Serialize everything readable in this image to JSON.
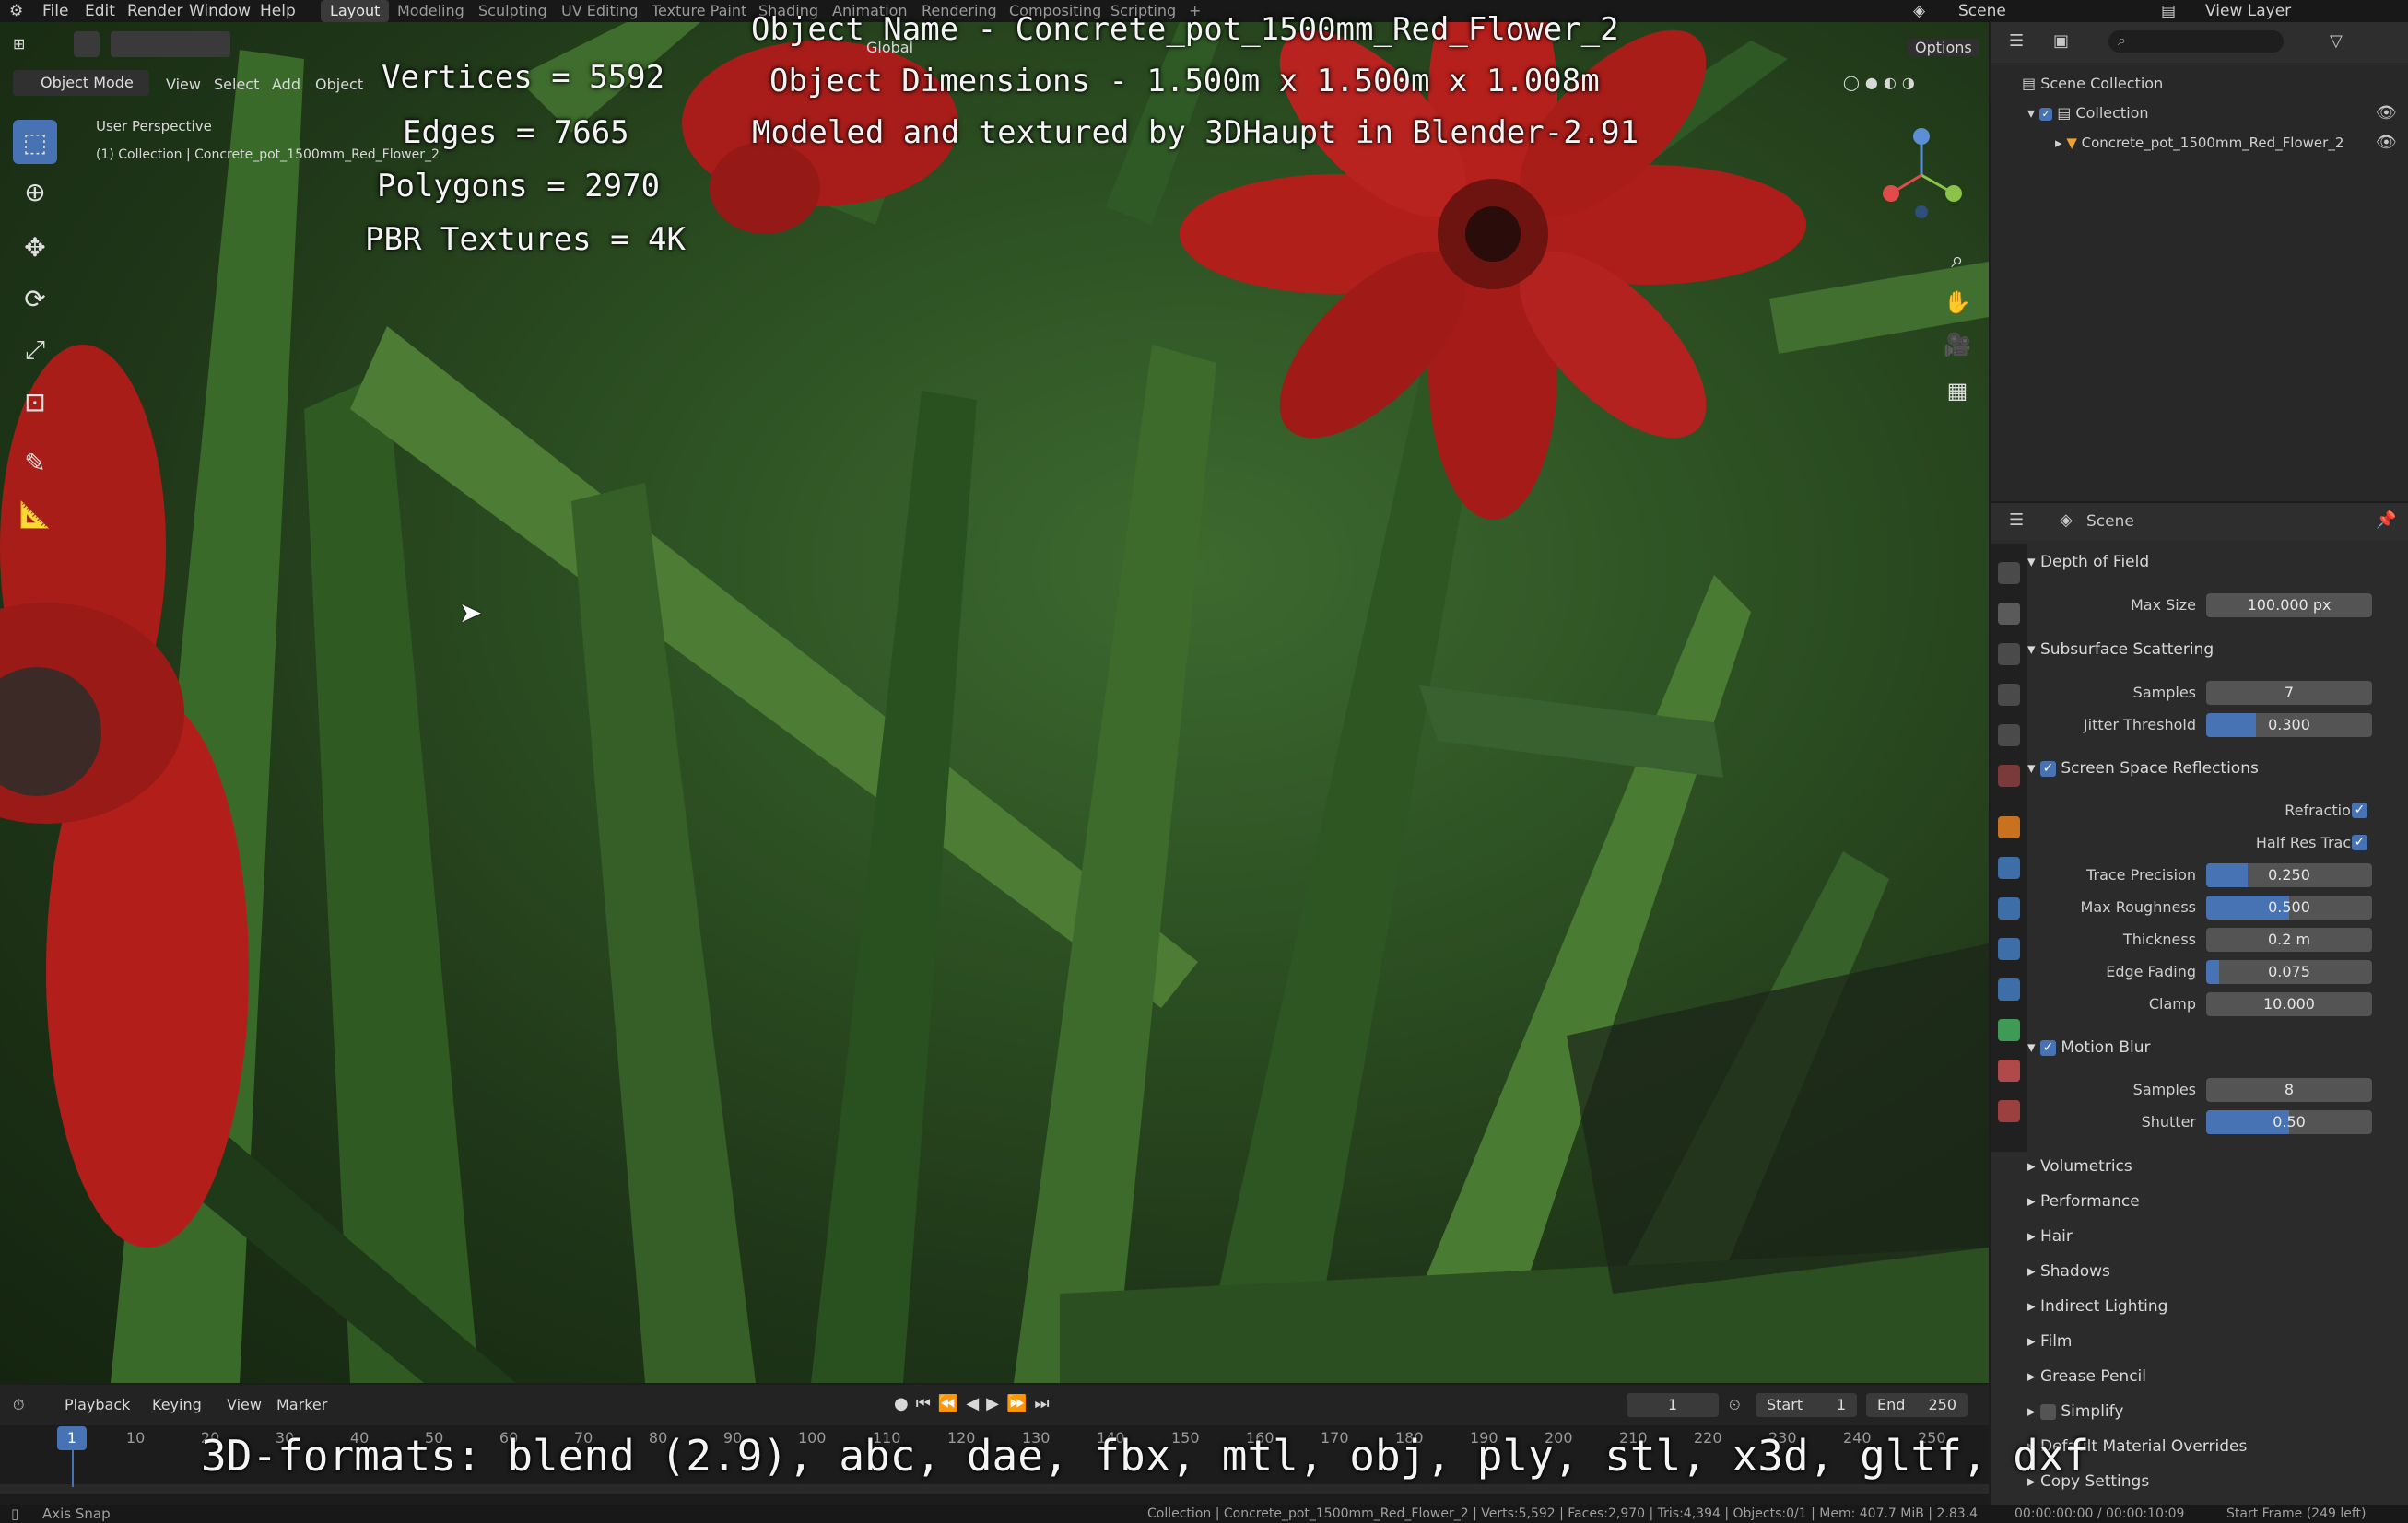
{
  "menubar": {
    "items": [
      "File",
      "Edit",
      "Render",
      "Window",
      "Help"
    ],
    "workspaces": [
      "Layout",
      "Modeling",
      "Sculpting",
      "UV Editing",
      "Texture Paint",
      "Shading",
      "Animation",
      "Rendering",
      "Compositing",
      "Scripting"
    ],
    "active_workspace": "Layout",
    "scene": "Scene",
    "view_layer": "View Layer"
  },
  "viewport": {
    "mode": "Object Mode",
    "menus": [
      "View",
      "Select",
      "Add",
      "Object"
    ],
    "orientation": "Global",
    "options_label": "Options",
    "perspective": "User Perspective",
    "collection_path": "(1) Collection | Concrete_pot_1500mm_Red_Flower_2",
    "overlay": {
      "vertices": "Vertices = 5592",
      "edges": "Edges = 7665",
      "polygons": "Polygons = 2970",
      "textures": "PBR Textures = 4K",
      "name": "Object Name - Concrete_pot_1500mm_Red_Flower_2",
      "dimensions": "Object Dimensions -  1.500m x 1.500m x 1.008m",
      "credit": "Modeled and textured by 3DHaupt in Blender-2.91",
      "formats": "3D-formats: blend (2.9), abc, dae, fbx, mtl, obj, ply, stl, x3d, gltf, dxf"
    }
  },
  "outliner": {
    "scene_collection": "Scene Collection",
    "collection": "Collection",
    "object": "Concrete_pot_1500mm_Red_Flower_2"
  },
  "properties": {
    "context": "Scene",
    "dof": {
      "title": "Depth of Field",
      "max_size_label": "Max Size",
      "max_size": "100.000 px"
    },
    "sss": {
      "title": "Subsurface Scattering",
      "samples_label": "Samples",
      "samples": "7",
      "jitter_label": "Jitter Threshold",
      "jitter": "0.300",
      "jitter_frac": 0.3
    },
    "ssr": {
      "title": "Screen Space Reflections",
      "refraction_label": "Refraction",
      "half_res_label": "Half Res Trace",
      "trace_precision_label": "Trace Precision",
      "trace_precision": "0.250",
      "trace_precision_frac": 0.25,
      "max_roughness_label": "Max Roughness",
      "max_roughness": "0.500",
      "max_roughness_frac": 0.5,
      "thickness_label": "Thickness",
      "thickness": "0.2 m",
      "edge_fading_label": "Edge Fading",
      "edge_fading": "0.075",
      "edge_fading_frac": 0.075,
      "clamp_label": "Clamp",
      "clamp": "10.000"
    },
    "motion_blur": {
      "title": "Motion Blur",
      "samples_label": "Samples",
      "samples": "8",
      "shutter_label": "Shutter",
      "shutter": "0.50",
      "shutter_frac": 0.5
    },
    "collapsed": [
      "Volumetrics",
      "Performance",
      "Hair",
      "Shadows",
      "Indirect Lighting",
      "Film",
      "Grease Pencil",
      "Simplify",
      "Default Material Overrides",
      "Copy Settings"
    ]
  },
  "timeline": {
    "menus": [
      "Playback",
      "Keying",
      "View",
      "Marker"
    ],
    "current_frame": "1",
    "start_label": "Start",
    "start": "1",
    "end_label": "End",
    "end": "250",
    "ticks": [
      "1",
      "10",
      "20",
      "30",
      "40",
      "50",
      "60",
      "70",
      "80",
      "90",
      "100",
      "110",
      "120",
      "130",
      "140",
      "150",
      "160",
      "170",
      "180",
      "190",
      "200",
      "210",
      "220",
      "230",
      "240",
      "250"
    ]
  },
  "statusbar": {
    "left": "Axis Snap",
    "stats": "Collection | Concrete_pot_1500mm_Red_Flower_2 | Verts:5,592 | Faces:2,970 | Tris:4,394 | Objects:0/1 | Mem: 407.7 MiB | 2.83.4",
    "time": "00:00:00:00 / 00:00:10:09",
    "frame_info": "Start Frame (249 left)"
  },
  "colors": {
    "accent": "#4772b3",
    "flower_red": "#b5201c",
    "grass_green": "#3d6a2f"
  }
}
